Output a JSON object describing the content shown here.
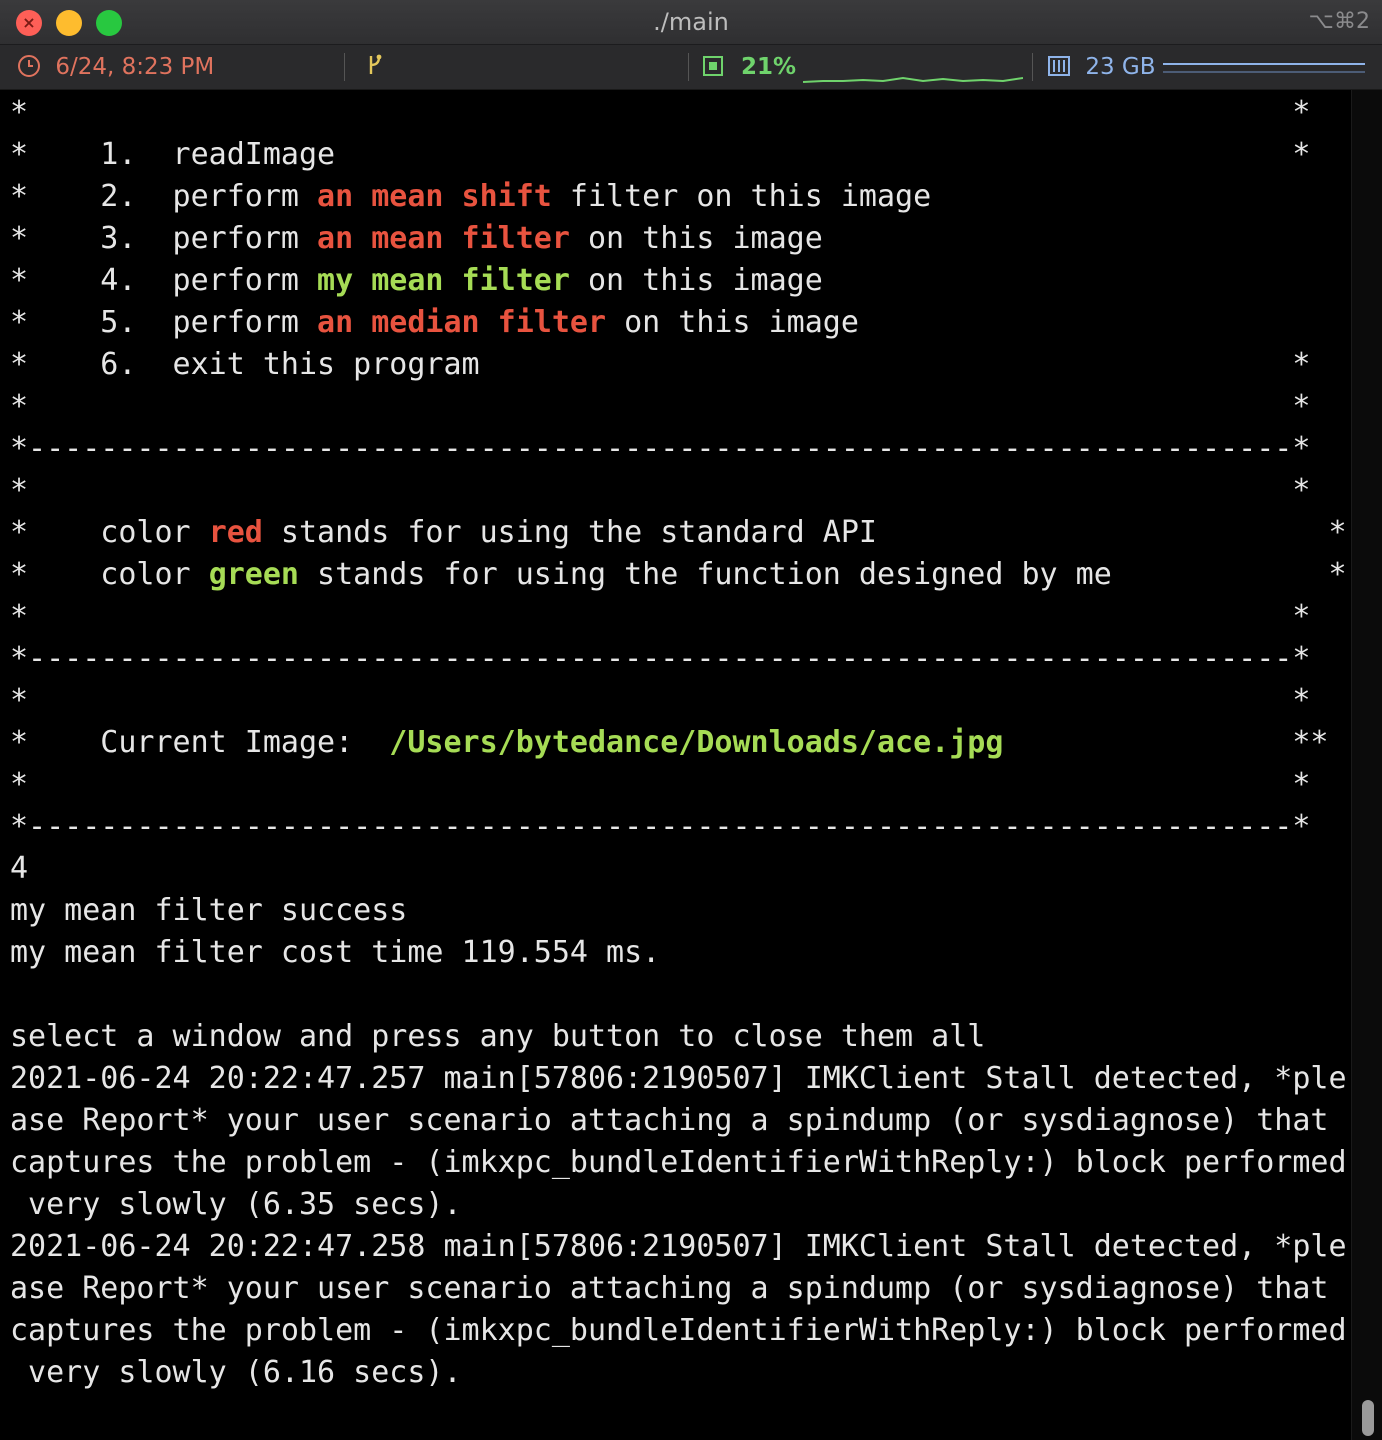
{
  "window": {
    "title": "./main",
    "shortcut": "⌥⌘2"
  },
  "status": {
    "datetime": "6/24, 8:23 PM",
    "git_icon": "branch-icon",
    "cpu": "21%",
    "memory": "23 GB"
  },
  "colors": {
    "red": "#e8533f",
    "green": "#a6dc55",
    "text": "#e6e6e6"
  },
  "terminal": {
    "lines": [
      [
        {
          "t": "*                                                                      *"
        }
      ],
      [
        {
          "t": "*    1.  readImage                                                     *"
        }
      ],
      [
        {
          "t": "*    2.  perform "
        },
        {
          "t": "an mean shift",
          "c": "r"
        },
        {
          "t": " filter on this image                           *"
        }
      ],
      [
        {
          "t": "*    3.  perform "
        },
        {
          "t": "an mean filter",
          "c": "r"
        },
        {
          "t": " on this image                                 *"
        }
      ],
      [
        {
          "t": "*    4.  perform "
        },
        {
          "t": "my mean filter",
          "c": "g"
        },
        {
          "t": " on this image                                 *"
        }
      ],
      [
        {
          "t": "*    5.  perform "
        },
        {
          "t": "an median filter",
          "c": "r"
        },
        {
          "t": " on this image                               *"
        }
      ],
      [
        {
          "t": "*    6.  exit this program                                             *"
        }
      ],
      [
        {
          "t": "*                                                                      *"
        }
      ],
      [
        {
          "t": "*----------------------------------------------------------------------*"
        }
      ],
      [
        {
          "t": "*                                                                      *"
        }
      ],
      [
        {
          "t": "*    color "
        },
        {
          "t": "red",
          "c": "r"
        },
        {
          "t": " stands for using the standard API                         *"
        }
      ],
      [
        {
          "t": "*    color "
        },
        {
          "t": "green",
          "c": "g"
        },
        {
          "t": " stands for using the function designed by me            *"
        }
      ],
      [
        {
          "t": "*                                                                      *"
        }
      ],
      [
        {
          "t": "*----------------------------------------------------------------------*"
        }
      ],
      [
        {
          "t": "*                                                                      *"
        }
      ],
      [
        {
          "t": "*    Current Image:  "
        },
        {
          "t": "/Users/bytedance/Downloads/ace.jpg",
          "c": "g"
        },
        {
          "t": "                **"
        }
      ],
      [
        {
          "t": "*                                                                      *"
        }
      ],
      [
        {
          "t": "*----------------------------------------------------------------------*"
        }
      ],
      [
        {
          "t": "4"
        }
      ],
      [
        {
          "t": "my mean filter success"
        }
      ],
      [
        {
          "t": "my mean filter cost time 119.554 ms."
        }
      ],
      [
        {
          "t": ""
        }
      ],
      [
        {
          "t": "select a window and press any button to close them all"
        }
      ],
      [
        {
          "t": "2021-06-24 20:22:47.257 main[57806:2190507] IMKClient Stall detected, *ple"
        }
      ],
      [
        {
          "t": "ase Report* your user scenario attaching a spindump (or sysdiagnose) that"
        }
      ],
      [
        {
          "t": "captures the problem - (imkxpc_bundleIdentifierWithReply:) block performed"
        }
      ],
      [
        {
          "t": " very slowly (6.35 secs)."
        }
      ],
      [
        {
          "t": "2021-06-24 20:22:47.258 main[57806:2190507] IMKClient Stall detected, *ple"
        }
      ],
      [
        {
          "t": "ase Report* your user scenario attaching a spindump (or sysdiagnose) that"
        }
      ],
      [
        {
          "t": "captures the problem - (imkxpc_bundleIdentifierWithReply:) block performed"
        }
      ],
      [
        {
          "t": " very slowly (6.16 secs)."
        }
      ]
    ]
  }
}
